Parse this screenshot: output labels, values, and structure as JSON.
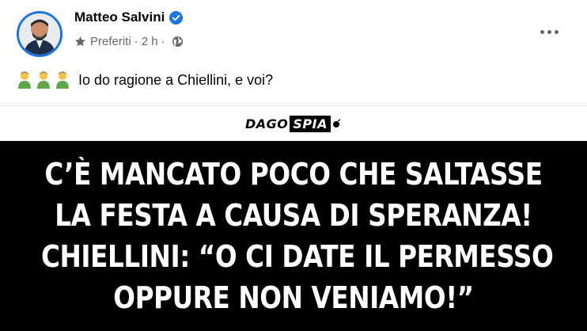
{
  "post": {
    "author_name": "Matteo Salvini",
    "audience_label": "Preferiti",
    "separator": "·",
    "timestamp": "2 h",
    "text": "Io do ragione a Chiellini, e voi?",
    "emoji_count": 3
  },
  "icons": {
    "verified": "verified-badge-icon",
    "audience": "star-icon",
    "privacy": "globe-icon",
    "more": "more-options-icon",
    "emoji": "person-emoji-icon"
  },
  "image": {
    "logo_left": "DAGO",
    "logo_right": "SPIA",
    "headline_lines": [
      "C’È MANCATO POCO CHE SALTASSE",
      "LA FESTA A CAUSA DI SPERANZA!",
      "CHIELLINI: “O CI DATE IL PERMESSO",
      "OPPURE NON VENIAMO!”"
    ]
  },
  "colors": {
    "accent": "#1b74e4",
    "secondary_text": "#65676b",
    "image_background": "#000000"
  }
}
